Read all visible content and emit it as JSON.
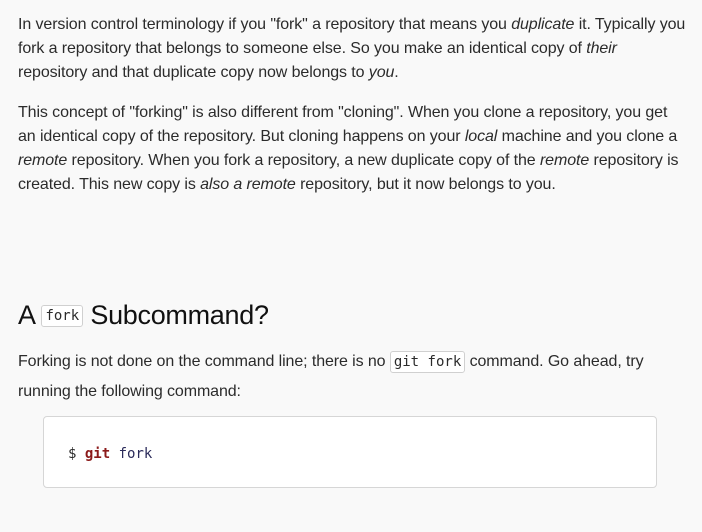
{
  "para1": {
    "s1": "In version control terminology if you \"fork\" a repository that means you ",
    "s1_em": "duplicate",
    "s2": " it. Typically you fork a repository that belongs to someone else. So you make an identical copy of ",
    "s2_em": "their",
    "s3": " repository and that duplicate copy now belongs to ",
    "s3_em": "you",
    "s4": "."
  },
  "para2": {
    "s1": "This concept of \"forking\" is also different from \"cloning\". When you clone a repository, you get an identical copy of the repository. But cloning happens on your ",
    "s1_em": "local",
    "s2": " machine and you clone a ",
    "s2_em": "remote",
    "s3": " repository. When you fork a repository, a new duplicate copy of the ",
    "s3_em": "remote",
    "s4": " repository is created. This new copy is ",
    "s4_em": "also a remote",
    "s5": " repository, but it now belongs to you."
  },
  "heading": {
    "prefix": "A",
    "code": "fork",
    "suffix": "Subcommand?"
  },
  "para3": {
    "s1": "Forking is not done on the command line; there is no ",
    "code": "git fork",
    "s2": " command. Go ahead, try running the following command:"
  },
  "codeblock": {
    "prompt": "$",
    "command": "git",
    "argument": "fork"
  }
}
